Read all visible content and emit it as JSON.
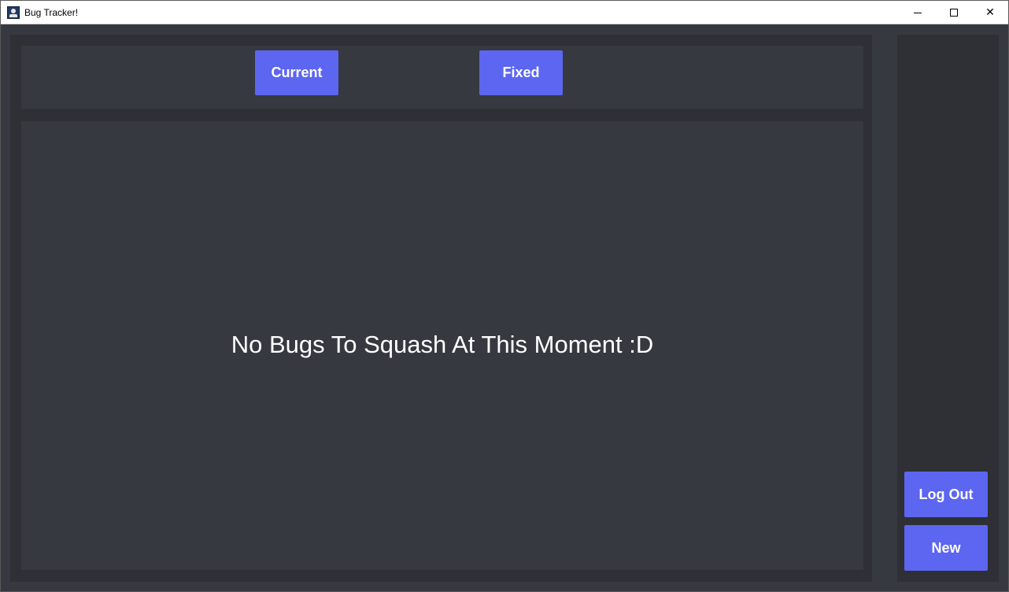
{
  "window": {
    "title": "Bug Tracker!",
    "controls": {
      "minimize": "",
      "maximize": "",
      "close": "✕"
    }
  },
  "tabs": {
    "current_label": "Current",
    "fixed_label": "Fixed"
  },
  "content": {
    "empty_message": "No Bugs To Squash At This Moment :D"
  },
  "sidebar": {
    "logout_label": "Log Out",
    "new_label": "New"
  },
  "colors": {
    "background": "#36393f",
    "panel": "#2e3035",
    "accent": "#5c66f0",
    "text": "#ffffff"
  }
}
